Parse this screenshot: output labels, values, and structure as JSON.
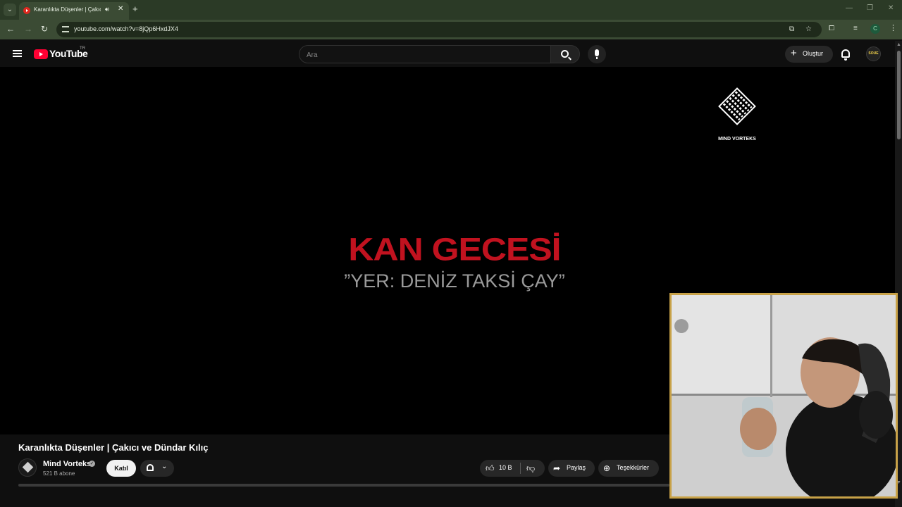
{
  "browser": {
    "tab": {
      "title": "Karanlıkta Düşenler | Çakıcı ve Dündar Kılıç",
      "audio_icon": "speaker-icon",
      "close_icon": "close-icon"
    },
    "new_tab_icon": "plus-icon",
    "url": "youtube.com/watch?v=8jQp6HxdJX4",
    "profile_initial": "C"
  },
  "header": {
    "logo_text": "YouTube",
    "region": "TR",
    "search": {
      "placeholder": "Ara",
      "value": ""
    },
    "create_label": "Oluştur",
    "account_avatar_text": "SOUE"
  },
  "player": {
    "brand_name": "MIND VORTEKS",
    "title_card": "KAN GECESİ",
    "subtitle_card": "”YER: DENİZ TAKSİ ÇAY”"
  },
  "video": {
    "title": "Karanlıkta Düşenler | Çakıcı ve Dündar Kılıç",
    "channel": {
      "name": "Mind Vorteks",
      "verified": true,
      "subscribers": "521 B abone"
    },
    "join_label": "Katıl",
    "likes": "10 B",
    "share_label": "Paylaş",
    "thanks_label": "Teşekkürler"
  },
  "colors": {
    "accent_red": "#ff0033",
    "title_card_red": "#c1121f",
    "webcam_border": "#c8a248",
    "chrome_bg": "#2b3a26"
  }
}
